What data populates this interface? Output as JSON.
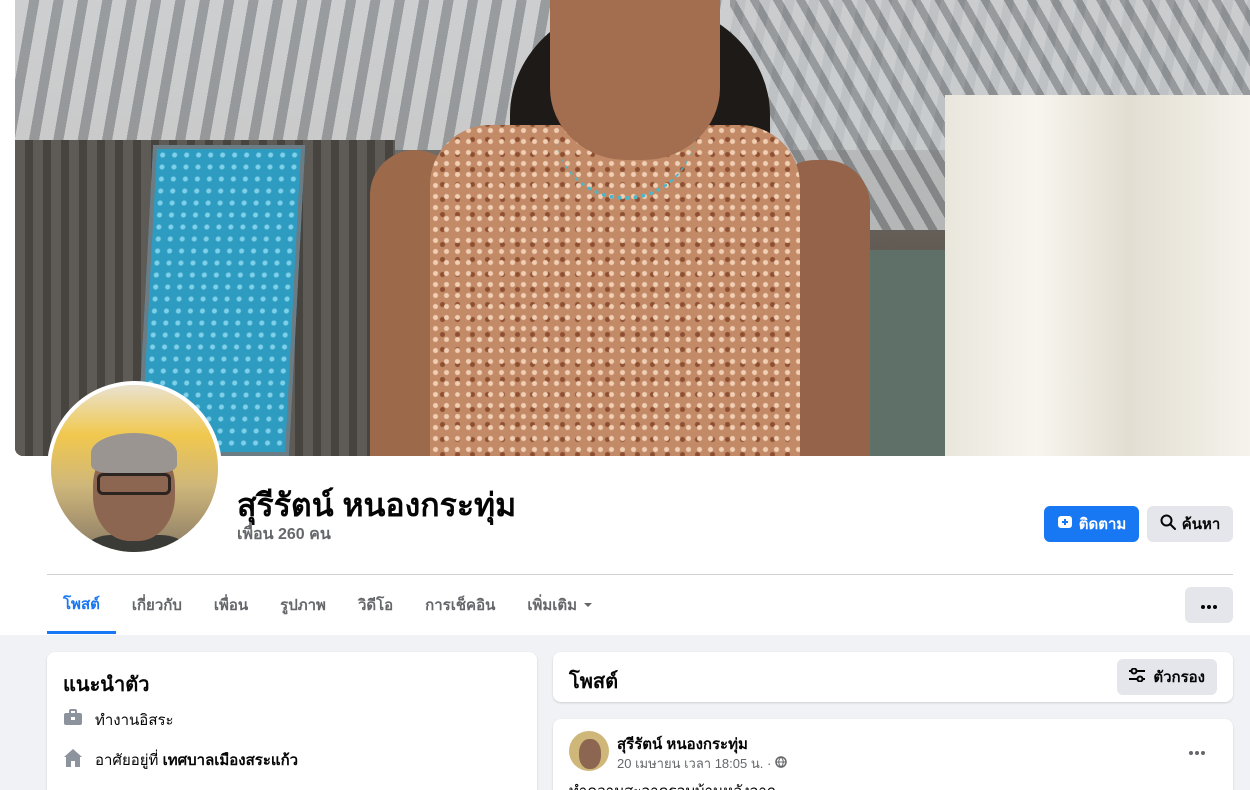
{
  "profile": {
    "name": "สุรีรัตน์ หนองกระทุ่ม",
    "friends": "เพื่อน 260 คน"
  },
  "actions": {
    "follow_label": "ติดตาม",
    "search_label": "ค้นหา"
  },
  "tabs": [
    {
      "label": "โพสต์",
      "active": true
    },
    {
      "label": "เกี่ยวกับ"
    },
    {
      "label": "เพื่อน"
    },
    {
      "label": "รูปภาพ"
    },
    {
      "label": "วิดีโอ"
    },
    {
      "label": "การเช็คอิน"
    },
    {
      "label": "เพิ่มเติม"
    }
  ],
  "intro": {
    "title": "แนะนำตัว",
    "work": "ทำงานอิสระ",
    "lives_prefix": "อาศัยอยู่ที่",
    "lives_place": "เทศบาลเมืองสระแก้ว"
  },
  "posts": {
    "title": "โพสต์",
    "filter_label": "ตัวกรอง"
  },
  "post": {
    "author": "สุรีรัตน์ หนองกระทุ่ม",
    "time": "20 เมษายน เวลา 18:05 น. ·",
    "text": "ทำความสะอาดรอบบ้านหลังจาก"
  },
  "colors": {
    "accent": "#1877f2",
    "secondary_button": "#e4e6eb",
    "page_background": "#f0f2f5",
    "muted_text": "#65676b"
  }
}
